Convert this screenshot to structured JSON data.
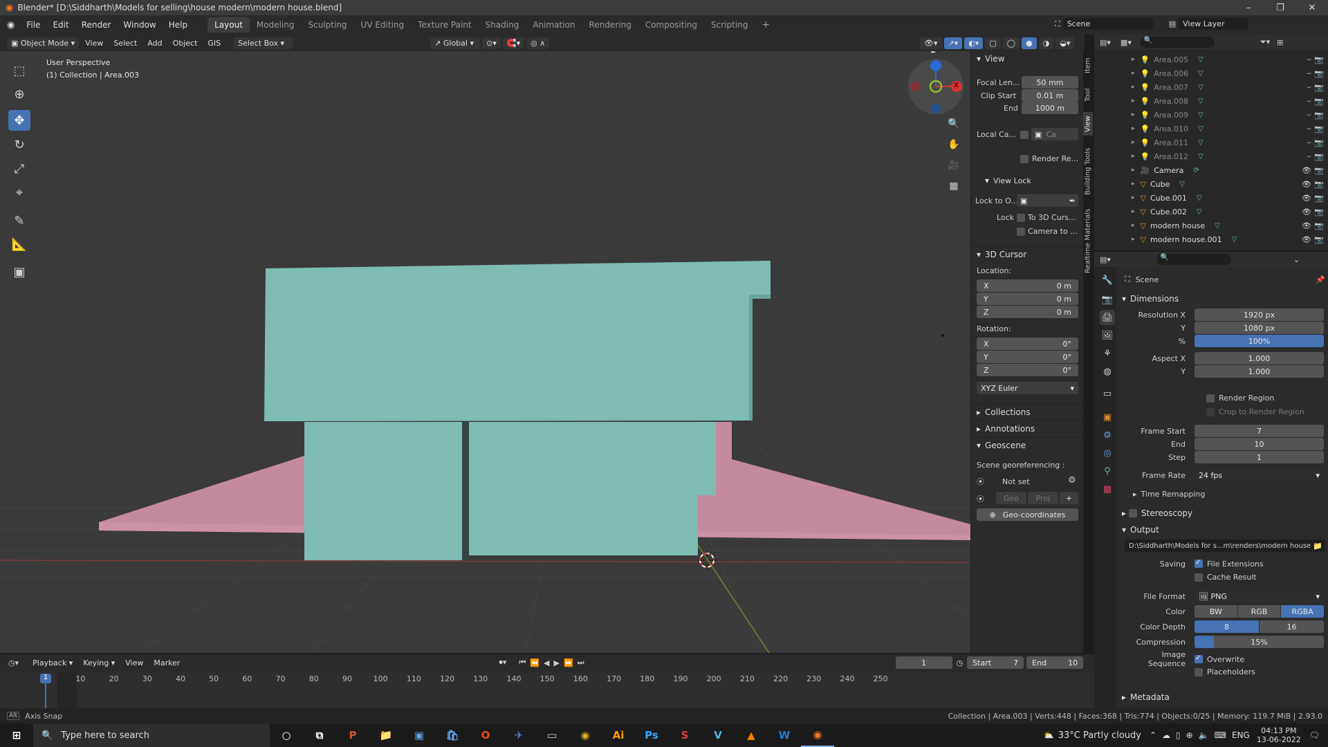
{
  "window": {
    "title": "Blender* [D:\\Siddharth\\Models for selling\\house modern\\modern house.blend]"
  },
  "menu": [
    "File",
    "Edit",
    "Render",
    "Window",
    "Help"
  ],
  "workspaces": [
    "Layout",
    "Modeling",
    "Sculpting",
    "UV Editing",
    "Texture Paint",
    "Shading",
    "Animation",
    "Rendering",
    "Compositing",
    "Scripting"
  ],
  "active_workspace": "Layout",
  "scene_name": "Scene",
  "view_layer": "View Layer",
  "header": {
    "mode": "Object Mode",
    "view": "View",
    "select": "Select",
    "add": "Add",
    "object": "Object",
    "gis": "GIS",
    "select_box": "Select Box",
    "orientation": "Global"
  },
  "viewport": {
    "perspective": "User Perspective",
    "collection_info": "(1) Collection | Area.003",
    "gizmo": {
      "x": "X",
      "y": "Y",
      "z": "Z"
    }
  },
  "npanel": {
    "view_title": "View",
    "focal_label": "Focal Len...",
    "focal_value": "50 mm",
    "clip_start_label": "Clip Start",
    "clip_start_value": "0.01 m",
    "clip_end_label": "End",
    "clip_end_value": "1000 m",
    "local_camera_label": "Local Ca...",
    "local_camera_value": "Ca",
    "render_region_label": "Render Re...",
    "view_lock_title": "View Lock",
    "lock_to_label": "Lock to O...",
    "lock_label": "Lock",
    "to_3d_cursor": "To 3D Curs...",
    "camera_to": "Camera to ...",
    "cursor_title": "3D Cursor",
    "location_label": "Location:",
    "loc": [
      {
        "axis": "X",
        "value": "0 m"
      },
      {
        "axis": "Y",
        "value": "0 m"
      },
      {
        "axis": "Z",
        "value": "0 m"
      }
    ],
    "rotation_label": "Rotation:",
    "rot": [
      {
        "axis": "X",
        "value": "0°"
      },
      {
        "axis": "Y",
        "value": "0°"
      },
      {
        "axis": "Z",
        "value": "0°"
      }
    ],
    "rotation_mode": "XYZ Euler",
    "collections": "Collections",
    "annotations": "Annotations",
    "geoscene": "Geoscene",
    "georef_label": "Scene georeferencing :",
    "not_set": "Not set",
    "geo": "Geo",
    "proj": "Proj",
    "geo_coordinates": "Geo-coordinates",
    "tabs": [
      "Item",
      "Tool",
      "View",
      "Building Tools",
      "Realtime Materials"
    ]
  },
  "outliner": {
    "items": [
      {
        "name": "Area.005",
        "type": "light",
        "dim": true
      },
      {
        "name": "Area.006",
        "type": "light",
        "dim": true
      },
      {
        "name": "Area.007",
        "type": "light",
        "dim": true
      },
      {
        "name": "Area.008",
        "type": "light",
        "dim": true
      },
      {
        "name": "Area.009",
        "type": "light",
        "dim": true
      },
      {
        "name": "Area.010",
        "type": "light",
        "dim": true
      },
      {
        "name": "Area.011",
        "type": "light",
        "dim": true
      },
      {
        "name": "Area.012",
        "type": "light",
        "dim": true
      },
      {
        "name": "Camera",
        "type": "camera",
        "dim": false
      },
      {
        "name": "Cube",
        "type": "mesh",
        "dim": false
      },
      {
        "name": "Cube.001",
        "type": "mesh",
        "dim": false
      },
      {
        "name": "Cube.002",
        "type": "mesh",
        "dim": false
      },
      {
        "name": "modern house",
        "type": "mesh",
        "dim": false
      },
      {
        "name": "modern house.001",
        "type": "mesh",
        "dim": false
      }
    ]
  },
  "properties": {
    "scene": "Scene",
    "dimensions": "Dimensions",
    "res_x_label": "Resolution X",
    "res_x": "1920 px",
    "res_y_label": "Y",
    "res_y": "1080 px",
    "res_pct_label": "%",
    "res_pct": "100%",
    "aspect_x_label": "Aspect X",
    "aspect_x": "1.000",
    "aspect_y_label": "Y",
    "aspect_y": "1.000",
    "render_region": "Render Region",
    "crop_region": "Crop to Render Region",
    "frame_start_label": "Frame Start",
    "frame_start": "7",
    "end_label": "End",
    "frame_end": "10",
    "step_label": "Step",
    "step": "1",
    "frame_rate_label": "Frame Rate",
    "frame_rate": "24 fps",
    "time_remapping": "Time Remapping",
    "stereoscopy": "Stereoscopy",
    "output": "Output",
    "output_path": "D:\\Siddharth\\Models for s...m\\renders\\modern house",
    "saving_label": "Saving",
    "file_extensions": "File Extensions",
    "cache_result": "Cache Result",
    "file_format_label": "File Format",
    "file_format": "PNG",
    "color_label": "Color",
    "color_bw": "BW",
    "color_rgb": "RGB",
    "color_rgba": "RGBA",
    "depth_label": "Color Depth",
    "depth_8": "8",
    "depth_16": "16",
    "compression_label": "Compression",
    "compression": "15%",
    "compression_fraction": 0.15,
    "image_seq_label": "Image Sequence",
    "overwrite": "Overwrite",
    "placeholders": "Placeholders",
    "metadata": "Metadata"
  },
  "timeline": {
    "playback": "Playback",
    "keying": "Keying",
    "view": "View",
    "marker": "Marker",
    "current_frame": "1",
    "start_label": "Start",
    "start": "7",
    "end_label": "End",
    "end": "10",
    "ticks": [
      "1",
      "10",
      "20",
      "30",
      "40",
      "50",
      "60",
      "70",
      "80",
      "90",
      "100",
      "110",
      "120",
      "130",
      "140",
      "150",
      "160",
      "170",
      "180",
      "190",
      "200",
      "210",
      "220",
      "230",
      "240",
      "250"
    ]
  },
  "status": {
    "axis_snap": "Axis Snap",
    "stats": "Collection | Area.003 | Verts:448 | Faces:368 | Tris:774 | Objects:0/25 | Memory: 119.7 MiB | 2.93.0"
  },
  "taskbar": {
    "search_placeholder": "Type here to search",
    "weather": "33°C  Partly cloudy",
    "lang": "ENG",
    "time": "04:13 PM",
    "date": "13-06-2022"
  },
  "colors": {
    "accent": "#4772b3",
    "house": "#7ebcb4",
    "ground": "#c48a9e"
  }
}
